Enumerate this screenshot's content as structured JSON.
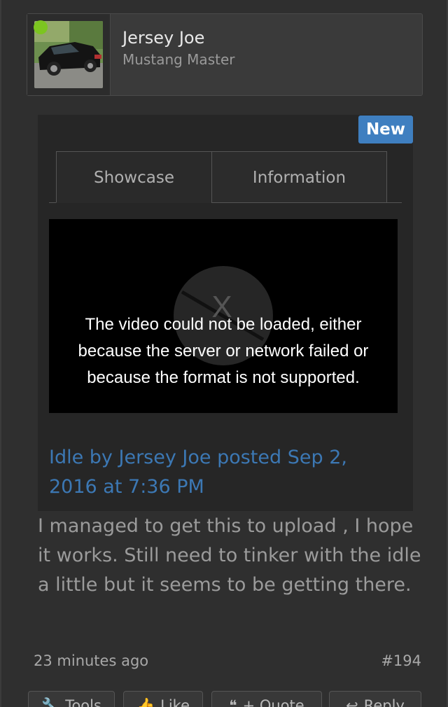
{
  "user": {
    "name": "Jersey Joe",
    "title": "Mustang Master",
    "online_color": "#7cc520"
  },
  "badge": {
    "label": "New",
    "color": "#3f7fc0"
  },
  "tabs": [
    {
      "label": "Showcase"
    },
    {
      "label": "Information"
    }
  ],
  "video": {
    "error_line1": "The video could not be loaded, either",
    "error_line2": "because the server or network failed or",
    "error_line3": "because the format is not supported."
  },
  "caption": {
    "text": "Idle by Jersey Joe posted Sep 2, 2016 at 7:36 PM"
  },
  "post": {
    "body": "I managed to get this to upload , I hope it works. Still need to tinker with the idle a little but it seems to be getting there.",
    "time": "23 minutes ago",
    "number": "#194"
  },
  "actions": [
    {
      "label": "Tools",
      "icon": "wrench-icon"
    },
    {
      "label": "Like",
      "icon": "thumbs-up-icon"
    },
    {
      "label": "+ Quote",
      "icon": "quote-icon"
    },
    {
      "label": "Reply",
      "icon": "reply-icon"
    }
  ]
}
